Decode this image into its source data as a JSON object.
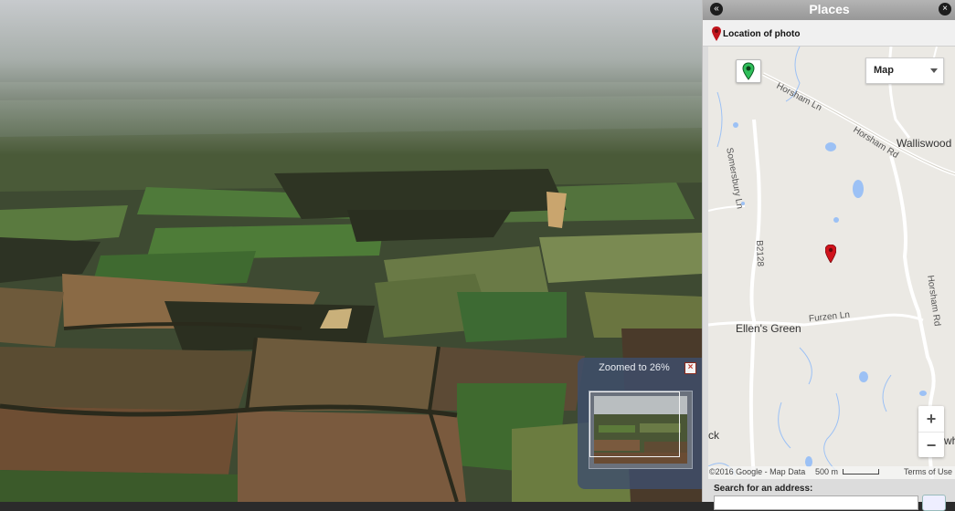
{
  "photo_viewer": {
    "zoom_label": "Zoomed to",
    "zoom_value": "26%",
    "zoom_close_icon": "close-icon",
    "zoom_level": 0.26
  },
  "places": {
    "title": "Places",
    "collapse_icon": "double-chevron-left-icon",
    "close_icon": "close-icon",
    "location_label": "Location of photo",
    "map": {
      "type_selected": "Map",
      "roads": [
        "Horsham Ln",
        "Horsham Rd",
        "Somersbury Ln",
        "B2128",
        "Furzen Ln",
        "Horsham Rd"
      ],
      "places": [
        "Walliswood",
        "Ellen's Green",
        "ck",
        "wh"
      ],
      "attribution": "2016 Google - Map Data",
      "scale": "500 m",
      "terms": "Terms of Use",
      "zoom_in": "+",
      "zoom_out": "−"
    },
    "search_label": "Search for an address:",
    "search_value": ""
  }
}
